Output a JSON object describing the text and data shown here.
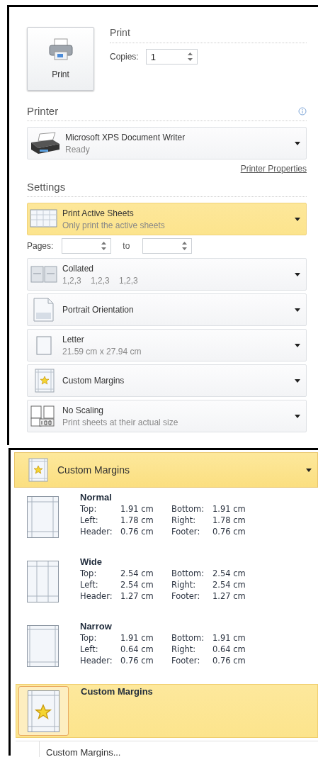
{
  "print_button": {
    "label": "Print"
  },
  "print_section": {
    "title": "Print",
    "copies_label": "Copies:",
    "copies_value": "1"
  },
  "printer": {
    "heading": "Printer",
    "name": "Microsoft XPS Document Writer",
    "status": "Ready",
    "properties_link": "Printer Properties"
  },
  "settings": {
    "heading": "Settings",
    "what_to_print": {
      "kind": "sheets",
      "title": "Print Active Sheets",
      "subtitle": "Only print the active sheets",
      "selected": true
    },
    "pages": {
      "label": "Pages:",
      "to_label": "to"
    },
    "dropdowns": [
      {
        "kind": "collate",
        "title": "Collated",
        "subtitle": "1,2,3    1,2,3    1,2,3",
        "selected": false
      },
      {
        "kind": "portrait",
        "title": "Portrait Orientation",
        "selected": false
      },
      {
        "kind": "letter",
        "title": "Letter",
        "subtitle": "21.59 cm x 27.94 cm",
        "selected": false
      },
      {
        "kind": "margins",
        "title": "Custom Margins",
        "selected": false
      },
      {
        "kind": "scaling",
        "title": "No Scaling",
        "subtitle": "Print sheets at their actual size",
        "selected": false
      }
    ]
  },
  "margins_menu": {
    "header": {
      "title": "Custom Margins"
    },
    "presets": [
      {
        "kind": "normal",
        "name": "Normal",
        "selected": false,
        "rows": [
          [
            "Top:",
            "1.91 cm",
            "Bottom:",
            "1.91 cm"
          ],
          [
            "Left:",
            "1.78 cm",
            "Right:",
            "1.78 cm"
          ],
          [
            "Header:",
            "0.76 cm",
            "Footer:",
            "0.76 cm"
          ]
        ]
      },
      {
        "kind": "wide",
        "name": "Wide",
        "selected": false,
        "rows": [
          [
            "Top:",
            "2.54 cm",
            "Bottom:",
            "2.54 cm"
          ],
          [
            "Left:",
            "2.54 cm",
            "Right:",
            "2.54 cm"
          ],
          [
            "Header:",
            "1.27 cm",
            "Footer:",
            "1.27 cm"
          ]
        ]
      },
      {
        "kind": "narrow",
        "name": "Narrow",
        "selected": false,
        "rows": [
          [
            "Top:",
            "1.91 cm",
            "Bottom:",
            "1.91 cm"
          ],
          [
            "Left:",
            "0.64 cm",
            "Right:",
            "0.64 cm"
          ],
          [
            "Header:",
            "0.76 cm",
            "Footer:",
            "0.76 cm"
          ]
        ]
      },
      {
        "kind": "custom",
        "name": "Custom Margins",
        "selected": true
      }
    ],
    "footer_item": "Custom Margins..."
  }
}
